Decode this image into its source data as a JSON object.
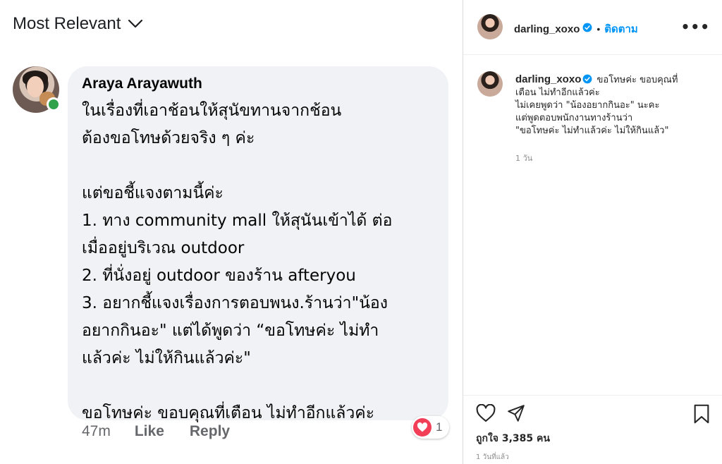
{
  "facebook": {
    "sort_label": "Most Relevant",
    "comment": {
      "author": "Araya Arayawuth",
      "lines": [
        "ในเรื่องที่เอาช้อนให้สุนัขทานจากช้อน",
        "ต้องขอโทษด้วยจริง ๆ ค่ะ",
        "",
        "แต่ขอชี้แจงตามนี้ค่ะ",
        "1. ทาง community mall ให้สุนันเข้าได้ ต่อ",
        "เมื่ออยู่บริเวณ outdoor",
        "2. ที่นั่งอยู่ outdoor ของร้าน afteryou",
        "3. อยากชี้แจงเรื่องการตอบพนง.ร้านว่า\"น้อง",
        "อยากกินอะ\" แต่ได้พูดว่า “ขอโทษค่ะ ไม่ทำ",
        "แล้วค่ะ ไม่ให้กินแล้วค่ะ\"",
        "",
        "ขอโทษค่ะ ขอบคุณที่เตือน ไม่ทำอีกแล้วค่ะ"
      ],
      "time": "47m",
      "like_label": "Like",
      "reply_label": "Reply",
      "reaction_count": "1",
      "reaction_icon": "heart-icon",
      "reaction_color": "#f33e58",
      "online_color": "#31a24c"
    }
  },
  "instagram": {
    "username": "darling_xoxo",
    "separator": "•",
    "follow_label": "ติดตาม",
    "follow_color": "#0095f6",
    "more_label": "•••",
    "caption": {
      "username": "darling_xoxo",
      "line1": "ขอโทษค่ะ ขอบคุณที่",
      "line2": "เตือน ไม่ทำอีกแล้วค่ะ",
      "line3": "ไม่เคยพูดว่า \"น้องอยากกินอะ\" นะคะ",
      "line4": "แต่พูดตอบพนักงานทางร้านว่า",
      "line5": "\"ขอโทษค่ะ ไม่ทำแล้วค่ะ ไม่ให้กินแล้ว\"",
      "time": "1 วัน"
    },
    "likes": "ถูกใจ 3,385 คน",
    "post_time": "1 วันที่แล้ว",
    "icons": [
      "heart-icon",
      "share-icon",
      "bookmark-icon"
    ]
  }
}
